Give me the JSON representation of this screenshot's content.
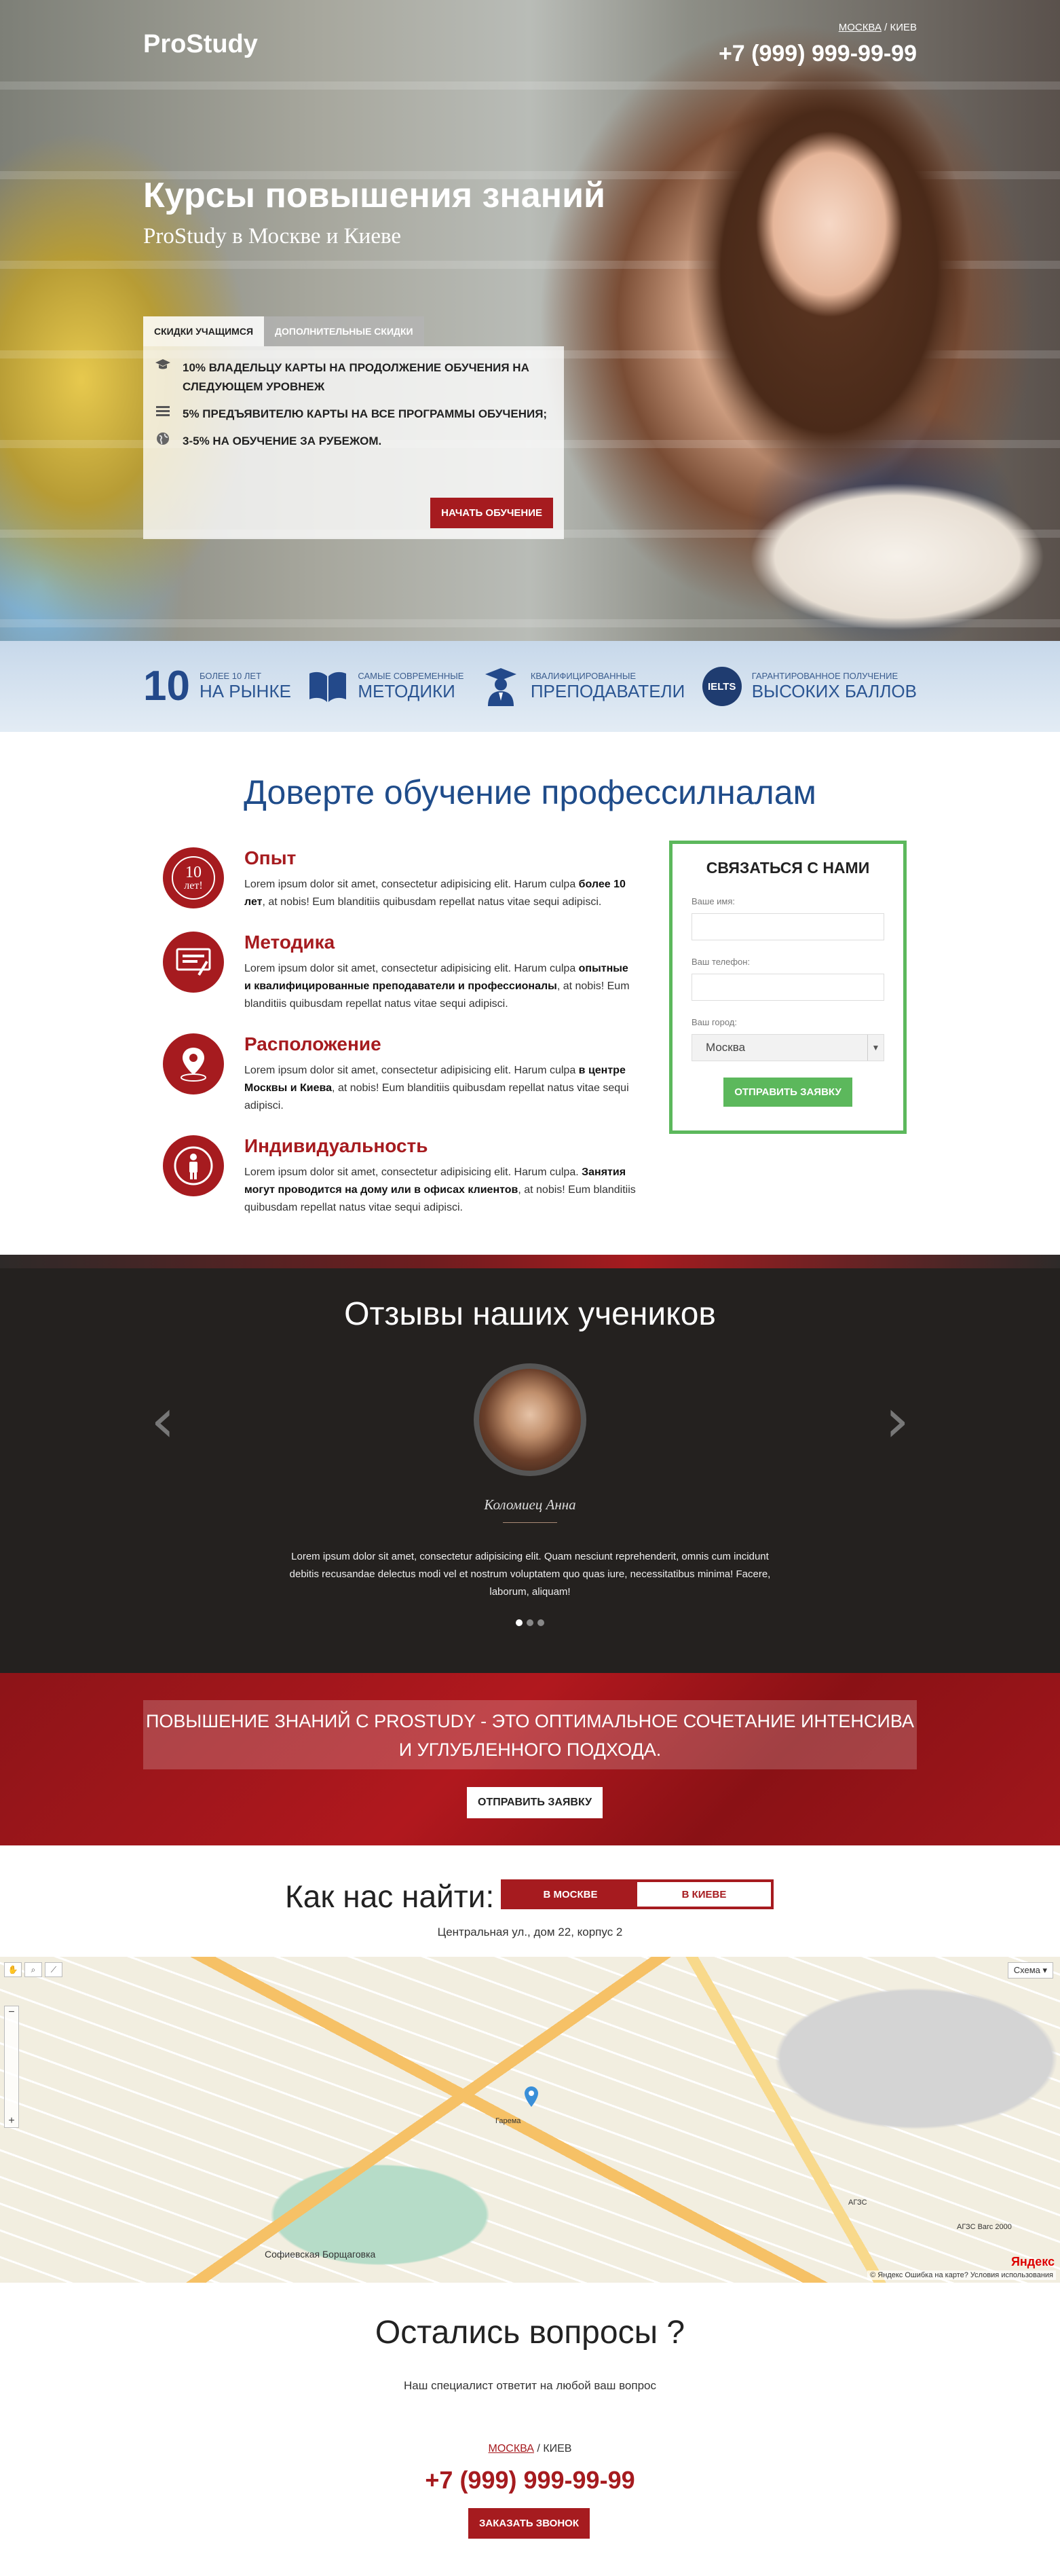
{
  "header": {
    "logo": "ProStudy",
    "city_active": "МОСКВА",
    "city_separator": " / ",
    "city_other": "КИЕВ",
    "phone": "+7 (999) 999-99-99"
  },
  "hero": {
    "title": "Курсы повышения знаний",
    "subtitle": "ProStudy в Москве и Киеве",
    "tabs": [
      {
        "label": "СКИДКИ УЧАЩИМСЯ",
        "active": true
      },
      {
        "label": "ДОПОЛНИТЕЛЬНЫЕ СКИДКИ",
        "active": false
      }
    ],
    "items": [
      {
        "icon": "graduation-cap-icon",
        "text": "10% ВЛАДЕЛЬЦУ КАРТЫ НА ПРОДОЛЖЕНИЕ ОБУЧЕНИЯ НА СЛЕДУЮЩЕМ УРОВНЕЖ"
      },
      {
        "icon": "list-icon",
        "text": "5% ПРЕДЪЯВИТЕЛЮ КАРТЫ НА ВСЕ ПРОГРАММЫ ОБУЧЕНИЯ;"
      },
      {
        "icon": "globe-icon",
        "text": "3-5% НА ОБУЧЕНИЕ ЗА РУБЕЖОМ."
      }
    ],
    "start_button": "НАЧАТЬ ОБУЧЕНИЕ"
  },
  "features": [
    {
      "big": "10",
      "small": "БОЛЕЕ 10 ЛЕТ",
      "main": "НА РЫНКЕ",
      "icon": "number-10"
    },
    {
      "small": "САМЫЕ СОВРЕМЕННЫЕ",
      "main": "МЕТОДИКИ",
      "icon": "book-icon"
    },
    {
      "small": "КВАЛИФИЦИРОВАННЫЕ",
      "main": "ПРЕПОДАВАТЕЛИ",
      "icon": "teacher-icon"
    },
    {
      "badge": "IELTS",
      "small": "ГАРАНТИРОВАННОЕ ПОЛУЧЕНИЕ",
      "main": "ВЫСОКИХ БАЛЛОВ",
      "icon": "ielts-badge"
    }
  ],
  "trust": {
    "title": "Доверте обучение профессилналам",
    "items": [
      {
        "title": "Опыт",
        "badge": "10\nлет!",
        "icon": "ten-years-icon",
        "text_pre": "Lorem ipsum dolor sit amet, consectetur adipisicing elit. Harum culpa ",
        "text_bold": "более 10 лет",
        "text_post": ", at nobis! Eum blanditiis quibusdam repellat natus vitae sequi adipisci."
      },
      {
        "title": "Методика",
        "icon": "method-icon",
        "text_pre": "Lorem ipsum dolor sit amet, consectetur adipisicing elit. Harum culpa ",
        "text_bold": "опытные и квалифицированные преподаватели и профессионалы",
        "text_post": ", at nobis! Eum blanditiis quibusdam repellat natus vitae sequi adipisci."
      },
      {
        "title": "Расположение",
        "icon": "location-icon",
        "text_pre": "Lorem ipsum dolor sit amet, consectetur adipisicing elit. Harum culpa ",
        "text_bold": "в центре Москвы и Киева",
        "text_post": ", at nobis! Eum blanditiis quibusdam repellat natus vitae sequi adipisci."
      },
      {
        "title": "Индивидуальность",
        "icon": "person-icon",
        "text_pre": "Lorem ipsum dolor sit amet, consectetur adipisicing elit. Harum culpa. ",
        "text_bold": "Занятия могут проводится на дому или в офисах клиентов",
        "text_post": ", at nobis! Eum blanditiis quibusdam repellat natus vitae sequi adipisci."
      }
    ]
  },
  "contact_form": {
    "title": "СВЯЗАТЬСЯ С НАМИ",
    "name_label": "Ваше имя:",
    "name_value": "",
    "phone_label": "Ваш телефон:",
    "phone_value": "",
    "city_label": "Ваш город:",
    "city_value": "Москва",
    "submit": "ОТПРАВИТЬ ЗАЯВКУ"
  },
  "reviews": {
    "title": "Отзывы наших учеников",
    "name": "Коломиец Анна",
    "text": "Lorem ipsum dolor sit amet, consectetur adipisicing elit. Quam nesciunt reprehenderit, omnis cum incidunt debitis recusandae delectus modi vel et nostrum voluptatem quo quas iure, necessitatibus minima! Facere, laborum, aliquam!",
    "dots": 3,
    "active_dot": 0
  },
  "promo": {
    "text": "ПОВЫШЕНИЕ ЗНАНИЙ С PROSTUDY - ЭТО ОПТИМАЛЬНОЕ СОЧЕТАНИЕ ИНТЕНСИВА И УГЛУБЛЕННОГО ПОДХОДА.",
    "button": "ОТПРАВИТЬ ЗАЯВКУ"
  },
  "find": {
    "title": "Как нас найти:",
    "tab_moscow": "В МОСКВЕ",
    "tab_kiev": "В КИЕВЕ",
    "address": "Центральная ул., дом 22, корпус 2"
  },
  "map": {
    "scheme": "Схема",
    "labels": [
      "Софиевская Борщаговка",
      "Гарема",
      "АГЗС",
      "АГЗС Вагс 2000"
    ],
    "yandex": "Яндекс",
    "copyright": "© Яндекс   Ошибка на карте?   Условия использования"
  },
  "questions": {
    "title": "Остались вопросы ?",
    "subtitle": "Наш специалист ответит на любой ваш вопрос",
    "city_active": "МОСКВА",
    "city_separator": " / ",
    "city_other": "КИЕВ",
    "phone": "+7 (999) 999-99-99",
    "button": "ЗАКАЗАТЬ ЗВОНОК"
  },
  "colors": {
    "accent_red": "#a61b1f",
    "blue": "#23498a",
    "green": "#5cb85c",
    "dark": "#24211f"
  }
}
